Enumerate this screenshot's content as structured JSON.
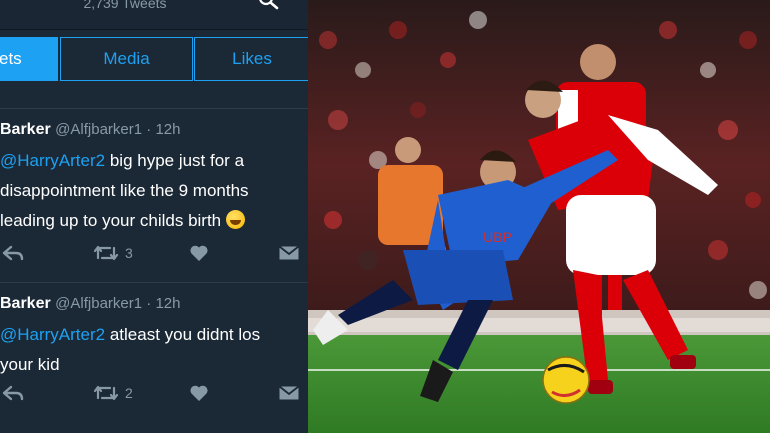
{
  "profile": {
    "tweet_count": "2,739 Tweets"
  },
  "tabs": [
    {
      "label": "ets"
    },
    {
      "label": "Media"
    },
    {
      "label": "Likes"
    }
  ],
  "tweets": [
    {
      "name": "Barker",
      "handle": "@Alfjbarker1",
      "time": "12h",
      "mention": "@HarryArter2",
      "lines": [
        " big hype just for a",
        "disappointment like the 9 months",
        "leading up to your childs birth "
      ],
      "retweets": "3"
    },
    {
      "name": "Barker",
      "handle": "@Alfjbarker1",
      "time": "12h",
      "mention": "@HarryArter2",
      "lines": [
        " atleast you didnt los",
        "your kid"
      ],
      "retweets": "2"
    }
  ],
  "icons": {
    "search": "search-icon",
    "reply": "reply-icon",
    "retweet": "retweet-icon",
    "like": "heart-icon",
    "message": "message-icon",
    "emoji": "laughing-emoji-icon"
  },
  "colors": {
    "accent": "#1da1f2",
    "background": "#1b2836",
    "secondary_text": "#8899a6",
    "arsenal_red": "#db0007",
    "bournemouth_blue": "#1f5fcf",
    "pitch_green": "#3f8a2f"
  }
}
